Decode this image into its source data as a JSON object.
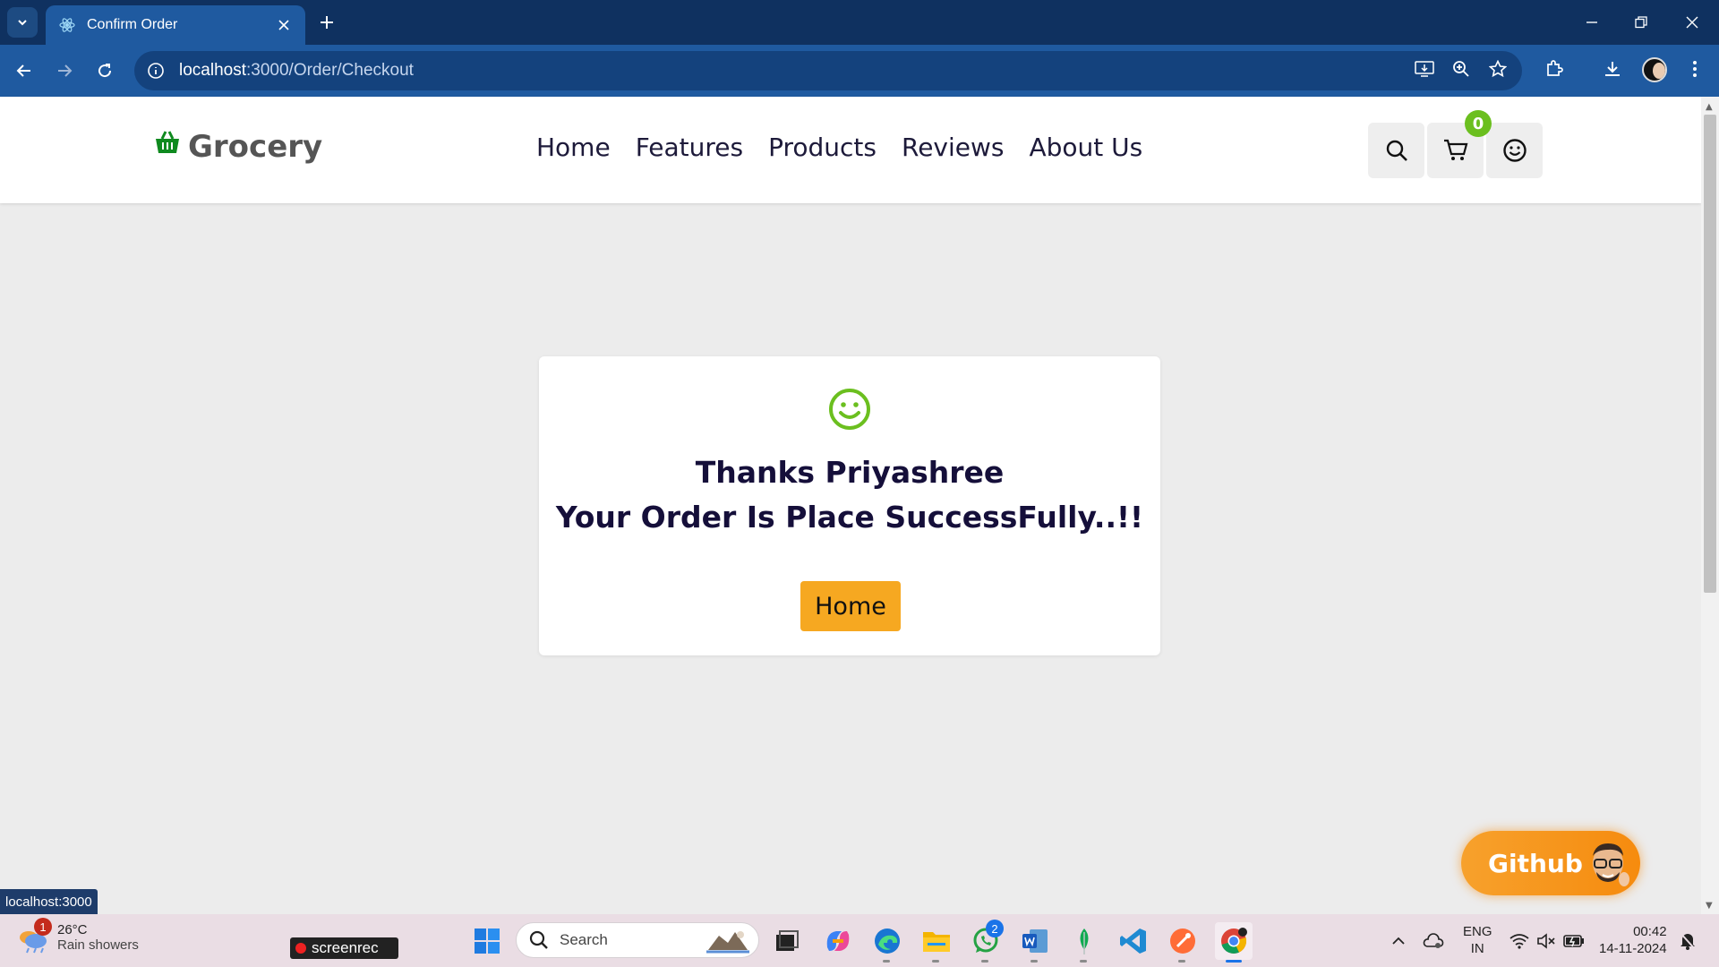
{
  "browser": {
    "tab_title": "Confirm Order",
    "url_host": "localhost",
    "url_path": ":3000/Order/Checkout",
    "status_url": "localhost:3000"
  },
  "header": {
    "logo_text": "Grocery",
    "nav": [
      "Home",
      "Features",
      "Products",
      "Reviews",
      "About Us"
    ],
    "cart_count": "0"
  },
  "confirmation": {
    "thanks_text": "Thanks Priyashree",
    "message": "Your Order Is Place SuccessFully..!!",
    "home_button": "Home"
  },
  "github_button": "Github",
  "taskbar": {
    "weather_badge": "1",
    "temperature": "26°C",
    "weather_desc": "Rain showers",
    "screenrec_label": "screenrec",
    "search_placeholder": "Search",
    "whatsapp_badge": "2",
    "lang_line1": "ENG",
    "lang_line2": "IN",
    "time": "00:42",
    "date": "14-11-2024"
  },
  "colors": {
    "brand_green": "#6bbf1f",
    "accent_orange": "#f6a821",
    "heading_navy": "#150f3a",
    "chrome_blue": "#1f5aa0"
  }
}
